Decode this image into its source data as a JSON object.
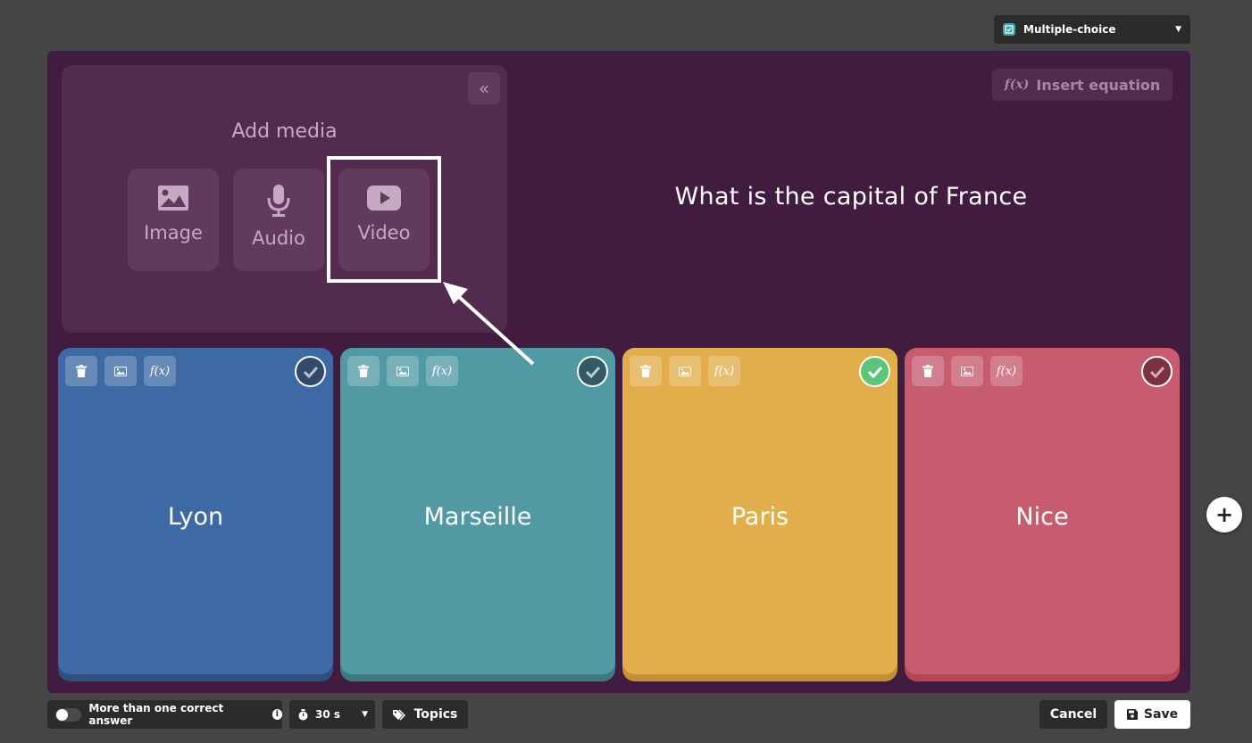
{
  "question_type": {
    "label": "Multiple-choice",
    "icon": "checkbox-icon"
  },
  "media_panel": {
    "title": "Add media",
    "image_label": "Image",
    "audio_label": "Audio",
    "video_label": "Video",
    "collapse_icon": "double-chevron-left-icon"
  },
  "editor": {
    "insert_equation_icon": "f(x)",
    "insert_equation_label": "Insert equation",
    "question_text": "What is the capital of France"
  },
  "answers": [
    {
      "text": "Lyon",
      "color": "#3d6aa5",
      "correct": false,
      "fx_label": "f(x)"
    },
    {
      "text": "Marseille",
      "color": "#529aa3",
      "correct": false,
      "fx_label": "f(x)"
    },
    {
      "text": "Paris",
      "color": "#e2ad4b",
      "correct": true,
      "fx_label": "f(x)"
    },
    {
      "text": "Nice",
      "color": "#c65c6d",
      "correct": false,
      "fx_label": "f(x)"
    }
  ],
  "footer": {
    "multi_correct_label": "More than one correct answer",
    "multi_correct_on": false,
    "info_glyph": "i",
    "timer_value": "30 s",
    "topics_label": "Topics",
    "cancel_label": "Cancel",
    "save_label": "Save"
  },
  "add_answer_glyph": "+"
}
